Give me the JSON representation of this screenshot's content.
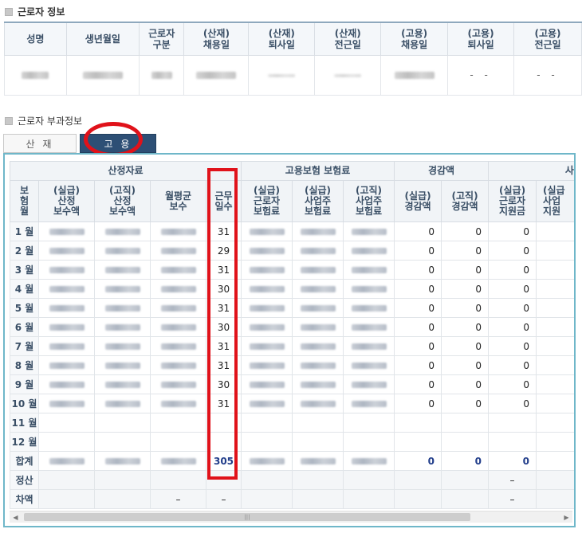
{
  "worker_info": {
    "title": "근로자 정보",
    "headers": [
      "성명",
      "생년월일",
      "근로자\n구분",
      "(산재)\n채용일",
      "(산재)\n퇴사일",
      "(산재)\n전근일",
      "(고용)\n채용일",
      "(고용)\n퇴사일",
      "(고용)\n전근일"
    ],
    "values": [
      "",
      "",
      "",
      "",
      "",
      "",
      "",
      "-  -",
      "-  -"
    ]
  },
  "levy_info": {
    "title": "근로자 부과정보",
    "tabs": [
      "산 재",
      "고 용"
    ],
    "active_tab": 1
  },
  "grid": {
    "group_headers": [
      "산정자료",
      "고용보험 보험료",
      "경감액",
      "사회보"
    ],
    "sub_headers": [
      "보\n험\n월",
      "(실급)\n산정\n보수액",
      "(고직)\n산정\n보수액",
      "월평균\n보수",
      "근무\n일수",
      "(실급)\n근로자\n보험료",
      "(실급)\n사업주\n보험료",
      "(고직)\n사업주\n보험료",
      "(실급)\n경감액",
      "(고직)\n경감액",
      "(실급)\n근로자\n지원금",
      "(실급\n사업\n지원"
    ],
    "rows": [
      {
        "month": "1 월",
        "days": "31",
        "red1": "0",
        "red2": "0",
        "sup": "0"
      },
      {
        "month": "2 월",
        "days": "29",
        "red1": "0",
        "red2": "0",
        "sup": "0"
      },
      {
        "month": "3 월",
        "days": "31",
        "red1": "0",
        "red2": "0",
        "sup": "0"
      },
      {
        "month": "4 월",
        "days": "30",
        "red1": "0",
        "red2": "0",
        "sup": "0"
      },
      {
        "month": "5 월",
        "days": "31",
        "red1": "0",
        "red2": "0",
        "sup": "0"
      },
      {
        "month": "6 월",
        "days": "30",
        "red1": "0",
        "red2": "0",
        "sup": "0"
      },
      {
        "month": "7 월",
        "days": "31",
        "red1": "0",
        "red2": "0",
        "sup": "0"
      },
      {
        "month": "8 월",
        "days": "31",
        "red1": "0",
        "red2": "0",
        "sup": "0"
      },
      {
        "month": "9 월",
        "days": "30",
        "red1": "0",
        "red2": "0",
        "sup": "0"
      },
      {
        "month": "10 월",
        "days": "31",
        "red1": "0",
        "red2": "0",
        "sup": "0"
      },
      {
        "month": "11 월",
        "days": "",
        "red1": "",
        "red2": "",
        "sup": ""
      },
      {
        "month": "12 월",
        "days": "",
        "red1": "",
        "red2": "",
        "sup": ""
      }
    ],
    "total": {
      "label": "합계",
      "days": "305",
      "red1": "0",
      "red2": "0",
      "sup": "0"
    },
    "settle": {
      "label": "정산",
      "sup": "–",
      "sup2": "–"
    },
    "diff": {
      "label": "차액",
      "avg": "–",
      "days": "–",
      "sup": "–",
      "sup2": "–"
    }
  },
  "colors": {
    "highlight": "#e0121a",
    "active_tab": "#2d4f75",
    "frame": "#6fb7c9",
    "total_text": "#213d8a"
  },
  "icons": {
    "scroll_left": "triangle-left",
    "scroll_right": "triangle-right",
    "thumb_grip": "grip-lines"
  }
}
